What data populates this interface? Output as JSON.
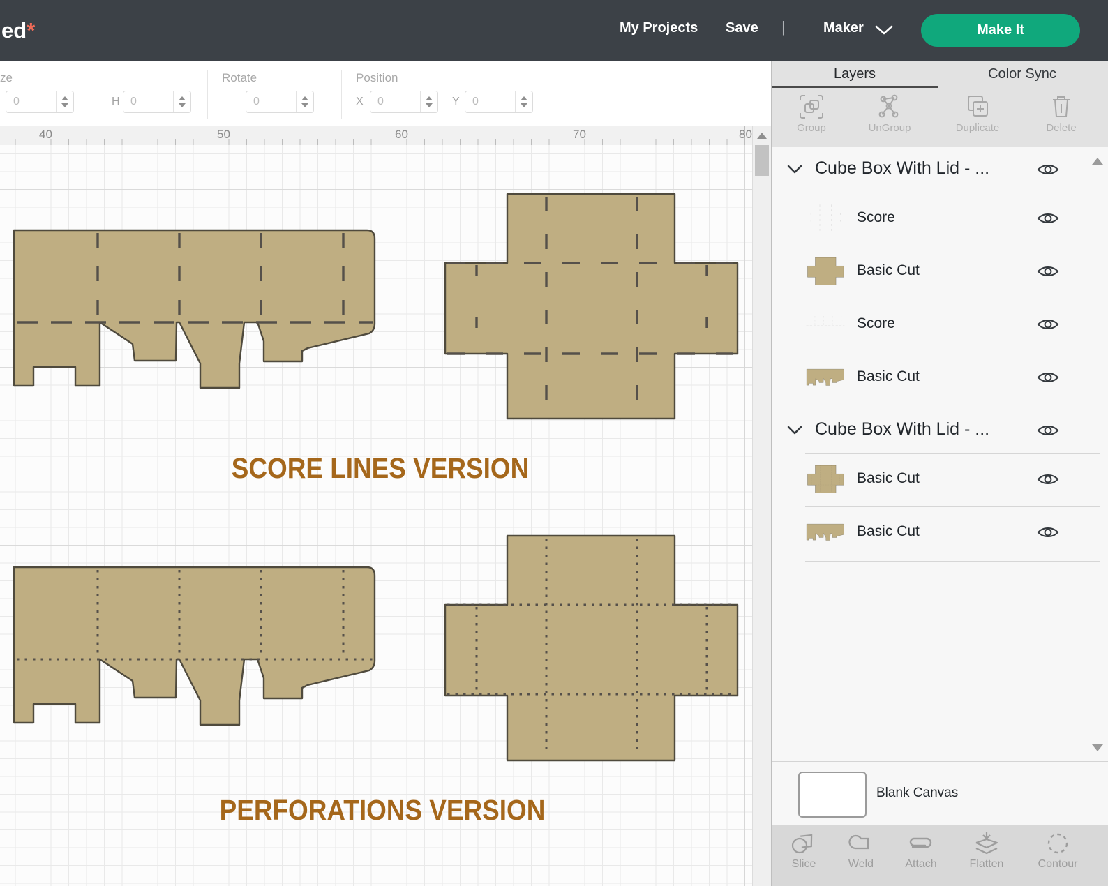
{
  "header": {
    "title_text": "ed",
    "unsaved_star": "*",
    "my_projects": "My Projects",
    "save": "Save",
    "nav_divider": "|",
    "machine": "Maker",
    "make_it": "Make It"
  },
  "toolbar": {
    "size_label": "ze",
    "w_value": "0",
    "h_label": "H",
    "h_value": "0",
    "rotate_label": "Rotate",
    "rotate_value": "0",
    "position_label": "Position",
    "x_label": "X",
    "x_value": "0",
    "y_label": "Y",
    "y_value": "0"
  },
  "ruler": {
    "ticks": [
      "40",
      "50",
      "60",
      "70",
      "80"
    ]
  },
  "canvas": {
    "score_caption": "SCORE LINES VERSION",
    "perforations_caption": "PERFORATIONS VERSION",
    "shape_fill": "#bfae82",
    "shape_outline": "#4f4a3d",
    "score_line_color": "#55504a",
    "caption_color": "#a5671b"
  },
  "panel": {
    "tabs": [
      "Layers",
      "Color Sync"
    ],
    "active_tab": "Layers",
    "actions": [
      "Group",
      "UnGroup",
      "Duplicate",
      "Delete"
    ],
    "groups": [
      {
        "name": "Cube Box With Lid - ...",
        "items": [
          {
            "label": "Score"
          },
          {
            "label": "Basic Cut"
          },
          {
            "label": "Score"
          },
          {
            "label": "Basic Cut"
          }
        ]
      },
      {
        "name": "Cube Box With Lid - ...",
        "items": [
          {
            "label": "Basic Cut"
          },
          {
            "label": "Basic Cut"
          }
        ]
      }
    ],
    "blank_canvas_label": "Blank Canvas",
    "bottom_actions": [
      "Slice",
      "Weld",
      "Attach",
      "Flatten",
      "Contour"
    ],
    "accent_green": "#10a87c"
  }
}
